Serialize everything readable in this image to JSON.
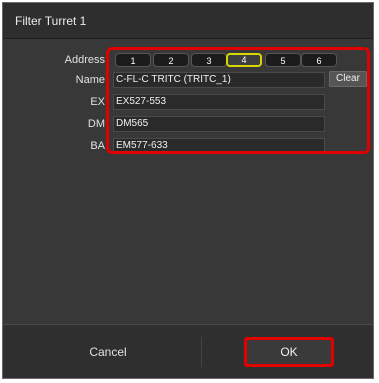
{
  "dialog": {
    "title": "Filter Turret 1",
    "labels": {
      "address": "Address",
      "name": "Name",
      "ex": "EX",
      "dm": "DM",
      "ba": "BA"
    },
    "address_buttons": [
      "1",
      "2",
      "3",
      "4",
      "5",
      "6"
    ],
    "selected_address": "4",
    "fields": {
      "name": "C-FL-C TRITC (TRITC_1)",
      "ex": "EX527-553",
      "dm": "DM565",
      "ba": "EM577-633"
    },
    "clear_label": "Clear",
    "cancel_label": "Cancel",
    "ok_label": "OK"
  },
  "colors": {
    "highlight": "#e00000",
    "selected_border": "#d8d800",
    "background": "#3a3a3a"
  }
}
